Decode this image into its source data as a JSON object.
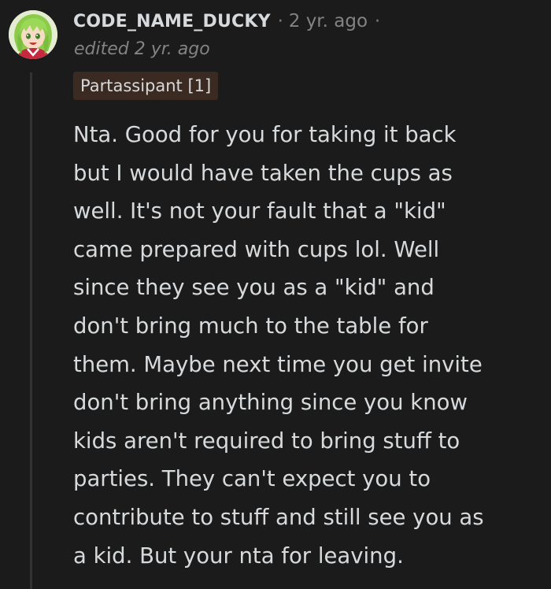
{
  "comment": {
    "username": "CODE_NAME_DUCKY",
    "separator": "·",
    "timestamp": "2 yr. ago",
    "edited": "edited 2 yr. ago",
    "flair": "Partassipant [1]",
    "avatar_icon": "anime-character-avatar-icon",
    "body_lines": [
      "Nta. Good for you for taking it back",
      "but I would have taken the cups as",
      "well. It's not your fault that a \"kid\"",
      "came prepared with cups lol. Well",
      "since they see you as a \"kid\" and",
      "don't bring much to the table for",
      "them. Maybe next time you get invite",
      "don't bring anything since you know",
      "kids aren't required to bring stuff to",
      "parties. They can't expect you to",
      "contribute to stuff and still see you as",
      "a kid. But your nta for leaving."
    ]
  },
  "colors": {
    "background": "#1b1b1b",
    "text_primary": "#d7dadc",
    "text_muted": "#818384",
    "flair_background": "#3a2a22",
    "thread_line": "#333333"
  }
}
